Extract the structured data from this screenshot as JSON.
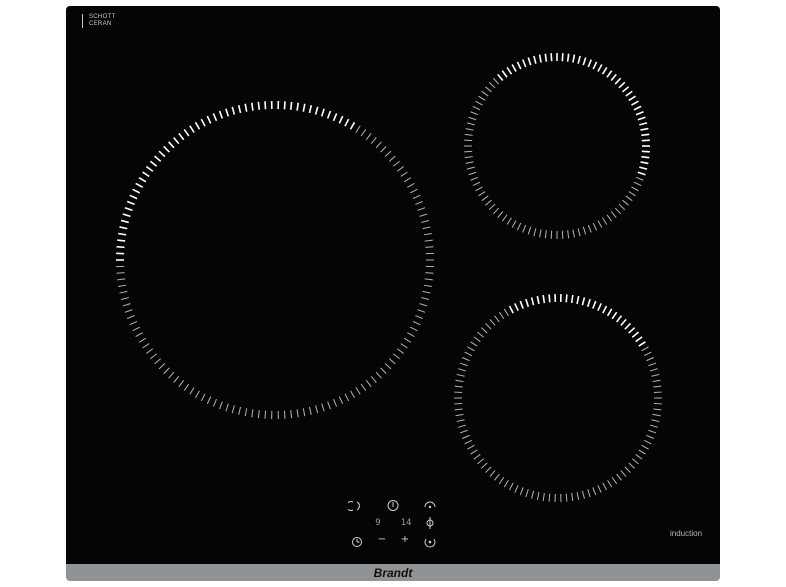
{
  "cooktop": {
    "logo_line1": "SCHOTT",
    "logo_line2": "CERAN",
    "induction_label": "induction",
    "brand": "Brandt",
    "glass_color": "#050505",
    "frame_color": "#8f9396",
    "zone_color": "#ffffff",
    "zones": [
      "large-left-zone",
      "small-top-right-zone",
      "medium-bottom-right-zone"
    ]
  },
  "controls": {
    "digit_left": "9",
    "digit_right": "14",
    "minus": "−",
    "plus": "+",
    "icons": [
      "zone-select-icon",
      "power-icon",
      "boost-icon",
      "lock-icon",
      "timer-icon",
      "pause-icon"
    ]
  }
}
